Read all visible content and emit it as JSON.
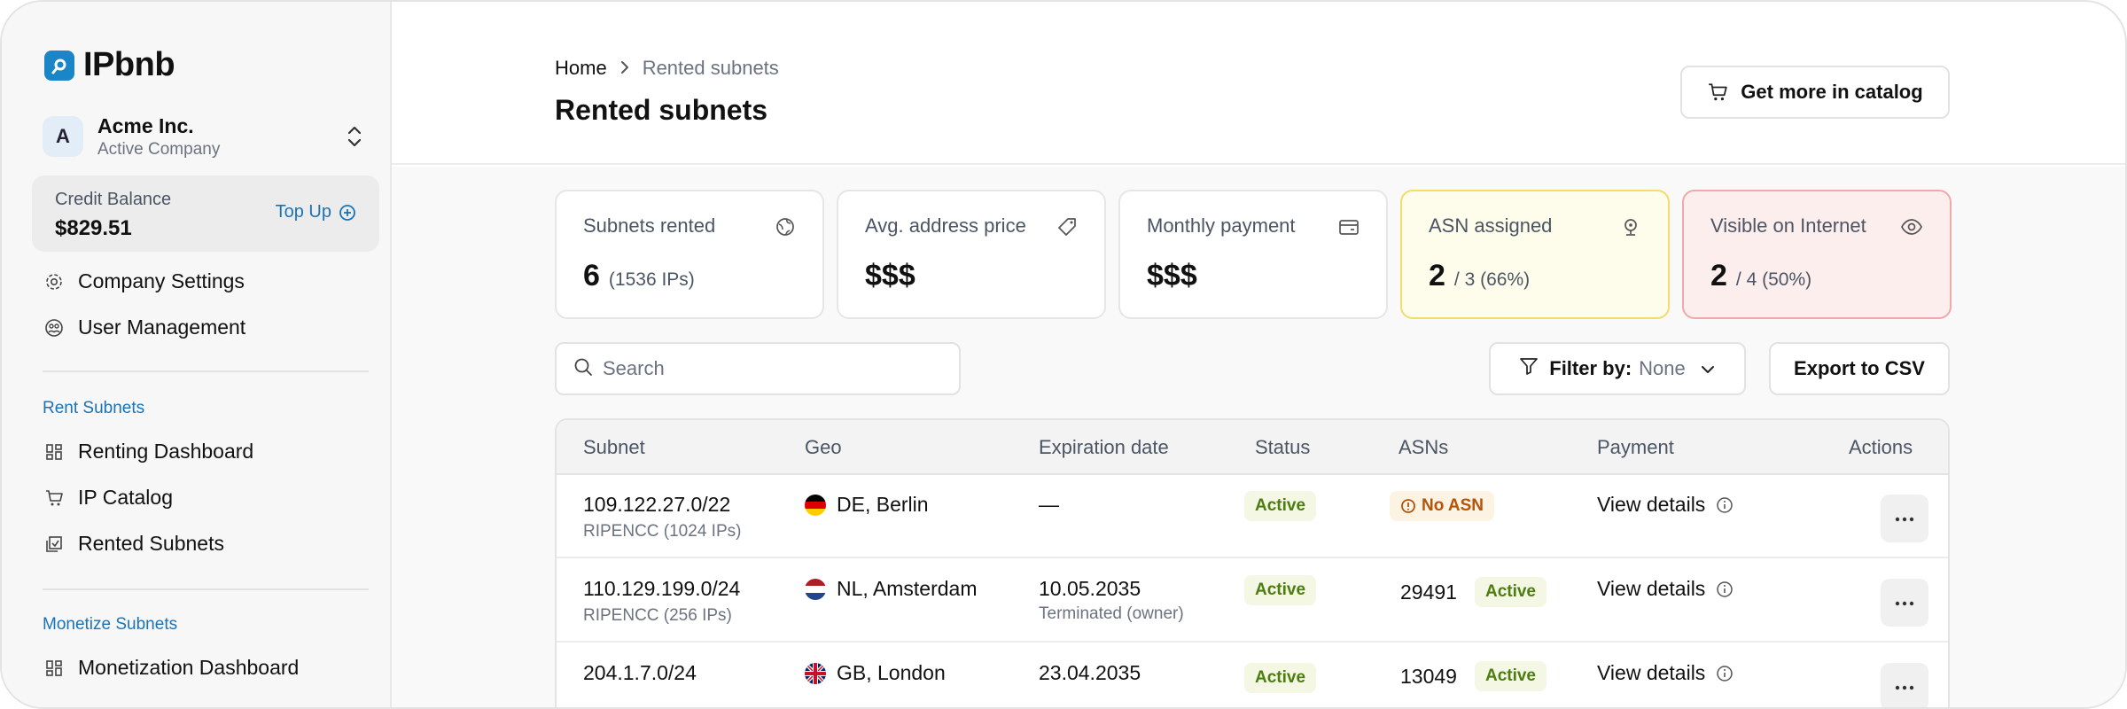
{
  "sidebar": {
    "brand": "IPbnb",
    "company": {
      "initial": "A",
      "name": "Acme Inc.",
      "subtitle": "Active Company"
    },
    "credit": {
      "label": "Credit Balance",
      "value": "$829.51",
      "topup_label": "Top Up"
    },
    "settings_items": [
      {
        "label": "Company Settings",
        "icon": "gear-icon"
      },
      {
        "label": "User Management",
        "icon": "users-icon"
      }
    ],
    "rent_section": {
      "label": "Rent Subnets",
      "items": [
        {
          "label": "Renting Dashboard",
          "icon": "grid-icon"
        },
        {
          "label": "IP Catalog",
          "icon": "cart-icon"
        },
        {
          "label": "Rented Subnets",
          "icon": "stack-check-icon"
        }
      ]
    },
    "monetize_section": {
      "label": "Monetize Subnets",
      "items": [
        {
          "label": "Monetization Dashboard",
          "icon": "grid-icon"
        }
      ]
    }
  },
  "header": {
    "breadcrumb": {
      "home": "Home",
      "current": "Rented subnets"
    },
    "title": "Rented subnets",
    "catalog_button": "Get more in catalog"
  },
  "stats": [
    {
      "label": "Subnets rented",
      "value": "6",
      "detail": "(1536 IPs)",
      "icon": "globe-icon"
    },
    {
      "label": "Avg. address price",
      "value": "$$$",
      "detail": "",
      "icon": "tag-icon"
    },
    {
      "label": "Monthly payment",
      "value": "$$$",
      "detail": "",
      "icon": "card-icon"
    },
    {
      "label": "ASN assigned",
      "value": "2",
      "detail": "/ 3 (66%)",
      "icon": "location-icon",
      "accent": "#f3dc6b"
    },
    {
      "label": "Visible on Internet",
      "value": "2",
      "detail": "/ 4 (50%)",
      "icon": "eye-icon",
      "accent": "#f0a9a9"
    }
  ],
  "toolbar": {
    "search_placeholder": "Search",
    "filter_label": "Filter by:",
    "filter_value": "None",
    "export_label": "Export to CSV"
  },
  "table": {
    "columns": [
      "Subnet",
      "Geo",
      "Expiration date",
      "Status",
      "ASNs",
      "Payment",
      "Actions"
    ],
    "rows": [
      {
        "subnet": "109.122.27.0/22",
        "registry": "RIPENCC (1024 IPs)",
        "geo": "DE, Berlin",
        "flag": "de",
        "expiration": "—",
        "expiration_note": "",
        "status": "Active",
        "asn": "",
        "asn_badge": "No ASN",
        "payment": "View details"
      },
      {
        "subnet": "110.129.199.0/24",
        "registry": "RIPENCC (256 IPs)",
        "geo": "NL, Amsterdam",
        "flag": "nl",
        "expiration": "10.05.2035",
        "expiration_note": "Terminated (owner)",
        "status": "Active",
        "asn": "29491",
        "asn_badge": "Active",
        "payment": "View details"
      },
      {
        "subnet": "204.1.7.0/24",
        "registry": "",
        "geo": "GB, London",
        "flag": "gb",
        "expiration": "23.04.2035",
        "expiration_note": "",
        "status": "Active",
        "asn": "13049",
        "asn_badge": "Active",
        "payment": "View details"
      }
    ]
  },
  "colors": {
    "accent": "#1a86c7",
    "link": "#1a73b8",
    "active_text": "#4d7c0f",
    "warning_text": "#b45309"
  }
}
